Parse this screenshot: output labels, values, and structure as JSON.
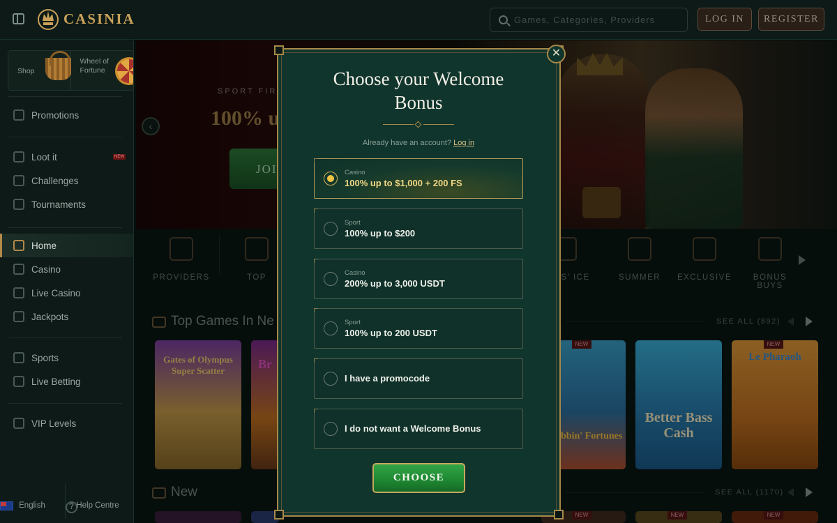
{
  "header": {
    "logo_text": "CASINIA",
    "search_placeholder": "Games, Categories, Providers",
    "login_label": "LOG IN",
    "register_label": "REGISTER"
  },
  "sidebar": {
    "promo_cards": [
      {
        "label": "Shop",
        "icon": "basket-icon"
      },
      {
        "label": "Wheel of Fortune",
        "icon": "wheel-icon"
      }
    ],
    "groups": [
      [
        {
          "label": "Promotions",
          "icon": "promotions-icon"
        }
      ],
      [
        {
          "label": "Loot it",
          "icon": "loot-icon",
          "badge": "NEW"
        },
        {
          "label": "Challenges",
          "icon": "challenges-icon"
        },
        {
          "label": "Tournaments",
          "icon": "trophy-icon"
        }
      ],
      [
        {
          "label": "Home",
          "icon": "home-icon",
          "active": true
        },
        {
          "label": "Casino",
          "icon": "casino-icon"
        },
        {
          "label": "Live Casino",
          "icon": "live-casino-icon"
        },
        {
          "label": "Jackpots",
          "icon": "jackpots-icon"
        }
      ],
      [
        {
          "label": "Sports",
          "icon": "sports-icon"
        },
        {
          "label": "Live Betting",
          "icon": "live-betting-icon"
        }
      ],
      [
        {
          "label": "VIP Levels",
          "icon": "vip-icon"
        }
      ]
    ],
    "footer": {
      "language": "English",
      "help": "Help Centre"
    }
  },
  "hero": {
    "subtitle": "SPORT FIRS",
    "title": "100% u",
    "button": "JOI"
  },
  "categories": [
    {
      "label": "PROVIDERS",
      "icon": "scroll-icon"
    },
    {
      "label": "TOP",
      "icon": "crown-icon"
    },
    {
      "label": "MERS' ICE",
      "icon": "gamers-choice-icon"
    },
    {
      "label": "SUMMER",
      "icon": "palm-icon"
    },
    {
      "label": "EXCLUSIVE",
      "icon": "diamond-icon"
    },
    {
      "label": "BONUS BUYS",
      "icon": "bonus-buys-icon"
    }
  ],
  "sections": {
    "top_games": {
      "title": "Top Games In Ne",
      "see_all": "SEE ALL (892)"
    },
    "new": {
      "title": "New",
      "see_all": "SEE ALL (1170)"
    }
  },
  "games": [
    {
      "title": "Gates of Olympus Super Scatter",
      "new": false
    },
    {
      "title": "Br",
      "new": false
    },
    {
      "title": "Crabbin' Fortunes",
      "new": true
    },
    {
      "title": "Better Bass Cash",
      "new": false
    },
    {
      "title": "Le Pharaoh",
      "new": true
    }
  ],
  "new_tag": "NEW",
  "modal": {
    "title": "Choose your Welcome Bonus",
    "already_text": "Already have an account?",
    "login_link": "Log in",
    "options": [
      {
        "category": "Casino",
        "label": "100% up to $1,000 + 200 FS",
        "selected": true
      },
      {
        "category": "Sport",
        "label": "100% up to $200",
        "selected": false
      },
      {
        "category": "Casino",
        "label": "200% up to 3,000 USDT",
        "selected": false
      },
      {
        "category": "Sport",
        "label": "100% up to 200 USDT",
        "selected": false
      },
      {
        "category": "",
        "label": "I have a promocode",
        "selected": false
      },
      {
        "category": "",
        "label": "I do not want a Welcome Bonus",
        "selected": false
      }
    ],
    "choose_label": "CHOOSE",
    "close_symbol": "✕"
  },
  "colors": {
    "gold": "#a68848",
    "modal_bg": "#10352c",
    "selected_text": "#f1d783",
    "choose_green": "#1f8a33"
  }
}
